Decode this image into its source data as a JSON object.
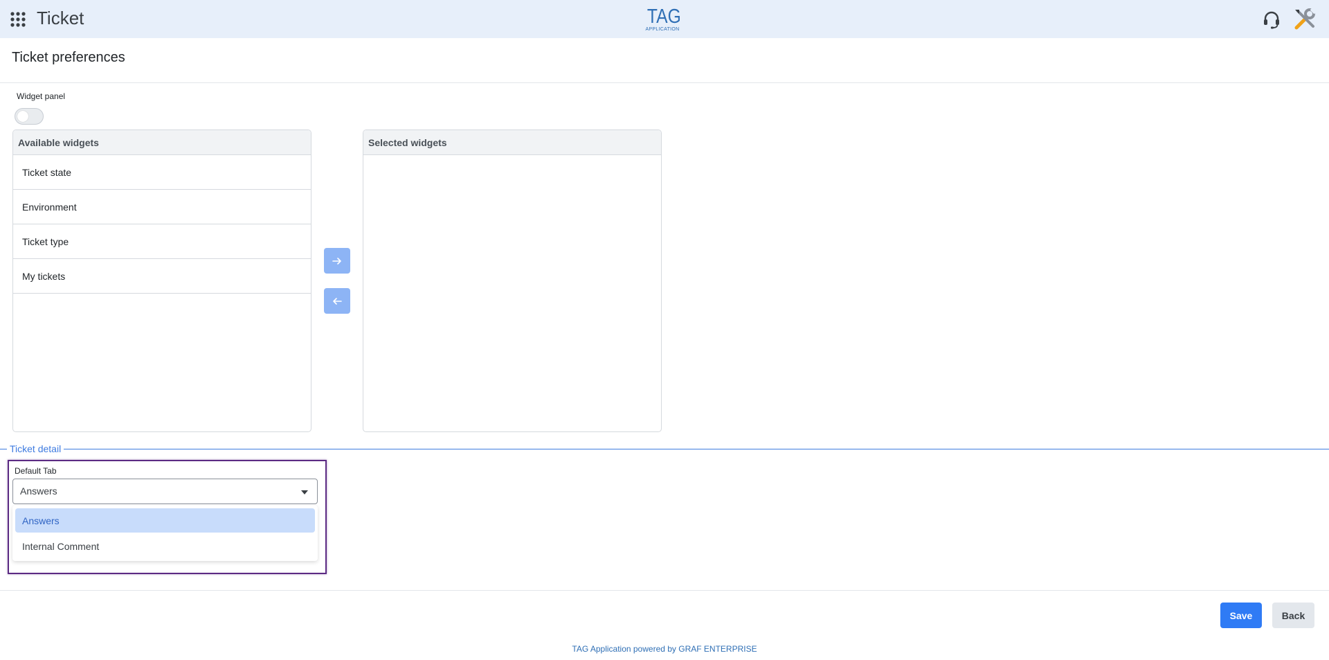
{
  "header": {
    "app_title": "Ticket",
    "logo_main": "TAG",
    "logo_sub": "APPLICATION",
    "icons": [
      "apps-grid-icon",
      "headset-icon",
      "tools-icon"
    ]
  },
  "page": {
    "title": "Ticket preferences"
  },
  "widget_panel": {
    "label": "Widget panel",
    "enabled": false
  },
  "available_widgets": {
    "header": "Available widgets",
    "items": [
      "Ticket state",
      "Environment",
      "Ticket type",
      "My tickets"
    ]
  },
  "selected_widgets": {
    "header": "Selected widgets",
    "items": []
  },
  "transfer": {
    "right_icon": "arrow-right-icon",
    "left_icon": "arrow-left-icon"
  },
  "ticket_detail": {
    "legend": "Ticket detail",
    "default_tab_label": "Default Tab",
    "default_tab_value": "Answers",
    "options": [
      "Answers",
      "Internal Comment"
    ],
    "highlighted_option": "Answers"
  },
  "actions": {
    "save_label": "Save",
    "back_label": "Back"
  },
  "footer": {
    "text": "TAG Application powered by GRAF ENTERPRISE"
  },
  "colors": {
    "header_bg": "#e7effa",
    "accent": "#2f7bf5",
    "transfer_button": "#8db4f5",
    "focus_outline": "#5b2a83",
    "link": "#2f6fb5"
  }
}
